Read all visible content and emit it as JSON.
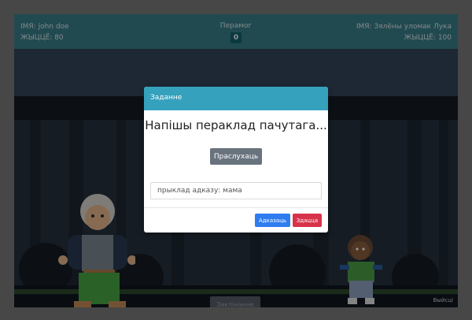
{
  "hud": {
    "player_name": "ІМЯ: john doe",
    "player_health": "ЖЫЦЦЁ: 80",
    "victories_label": "Перамог",
    "victories_count": "0",
    "enemy_name": "ІМЯ: Зялёны уломак Лука",
    "enemy_health": "ЖЫЦЦЁ: 100"
  },
  "scene": {
    "start_button_label": "Заклінанне",
    "exit_link": "Выйсці"
  },
  "modal": {
    "header": "Заданне",
    "prompt": "Напішы пераклад пачутага...",
    "listen_button": "Праслухаць",
    "answer_placeholder": "прыклад адказу: мама",
    "answer_value": "",
    "submit_button": "Адказаць",
    "giveup_button": "Здацца"
  },
  "colors": {
    "hud_bg": "#3a7e8a",
    "modal_header": "#35a1bd",
    "submit": "#2f7cf0",
    "giveup": "#d8334a",
    "listen": "#68737e"
  },
  "icons": {
    "player": "grey-haired-man-character",
    "enemy": "small-green-goblin-character"
  }
}
